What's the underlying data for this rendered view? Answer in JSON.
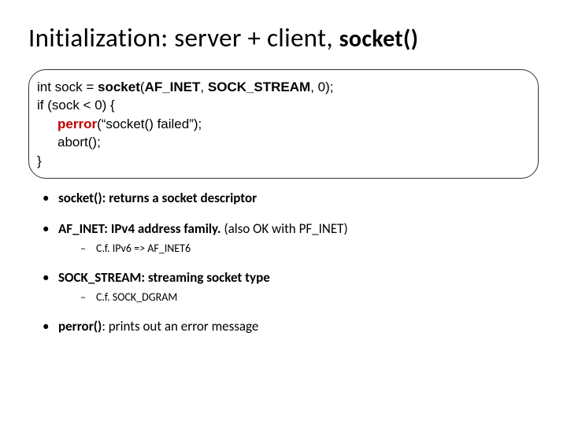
{
  "title": {
    "prefix": "Initialization: server + client, ",
    "fn": "socket()"
  },
  "code": {
    "l1a": "int sock = ",
    "l1b": "socket",
    "l1c": "(",
    "l1d": "AF_INET",
    "l1e": ", ",
    "l1f": "SOCK_STREAM",
    "l1g": ", 0);",
    "l2": "if (sock < 0) {",
    "l3a": "perror",
    "l3b": "(“socket() failed”);",
    "l4": "abort();",
    "l5": "}"
  },
  "bullets": {
    "b1": {
      "head": "socket(): ",
      "body": "returns a socket descriptor"
    },
    "b2": {
      "head": "AF_INET: IPv4 address family. ",
      "body": "(also OK with PF_INET)",
      "sub": "C.f. IPv6 => AF_INET6"
    },
    "b3": {
      "head": "SOCK_STREAM: streaming socket type",
      "sub": "C.f. SOCK_DGRAM"
    },
    "b4": {
      "head": "perror()",
      "body": ": prints out an error message"
    }
  }
}
